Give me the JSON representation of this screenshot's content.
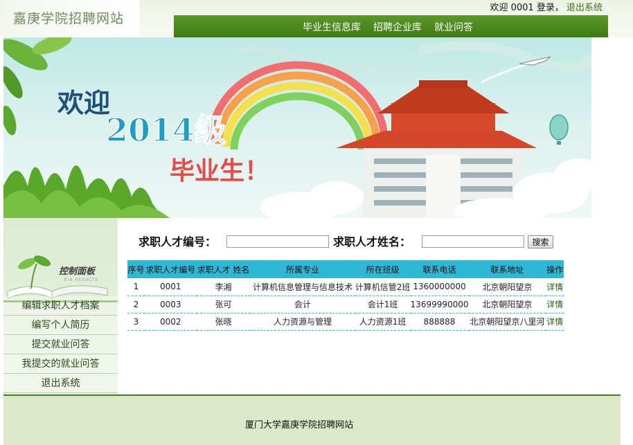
{
  "header": {
    "site_title": "嘉庚学院招聘网站",
    "welcome_prefix": "欢迎",
    "user_id": "0001",
    "login_suffix": "登录，",
    "logout_link": "退出系统",
    "nav": [
      "毕业生信息库",
      "招聘企业库",
      "就业问答"
    ]
  },
  "banner": {
    "text_welcome": "欢迎",
    "text_year": "2014级",
    "text_grad": "毕业生！"
  },
  "sidebar": {
    "panel_title": "控制面板",
    "panel_subtitle": "EIA RESULTS",
    "items": [
      "编辑求职人才档案",
      "编写个人简历",
      "提交就业问答",
      "我提交的就业问答",
      "退出系统"
    ]
  },
  "search": {
    "id_label": "求职人才编号：",
    "id_value": "",
    "name_label": "求职人才姓名：",
    "name_value": "",
    "button": "搜索"
  },
  "table": {
    "headers": [
      "序号",
      "求职人才编号",
      "求职人才 姓名",
      "所属专业",
      "所在班级",
      "联系电话",
      "联系地址",
      "操作"
    ],
    "rows": [
      [
        "1",
        "0001",
        "李湘",
        "计算机信息管理与信息技术",
        "计算机信管2班",
        "1360000000",
        "北京朝阳望京",
        "详情"
      ],
      [
        "2",
        "0003",
        "张可",
        "会计",
        "会计1班",
        "13699990000",
        "北京朝阳望京",
        "详情"
      ],
      [
        "3",
        "0002",
        "张晓",
        "人力资源与管理",
        "人力资源1班",
        "888888",
        "北京朝阳望京八里河",
        "详情"
      ]
    ]
  },
  "footer": {
    "text": "厦门大学嘉庚学院招聘网站"
  },
  "colors": {
    "nav_green": "#4a8a1d",
    "table_header": "#2fb8d6",
    "sidebar_bg": "#dcebd2",
    "footer_bg": "#dbe9c8"
  }
}
